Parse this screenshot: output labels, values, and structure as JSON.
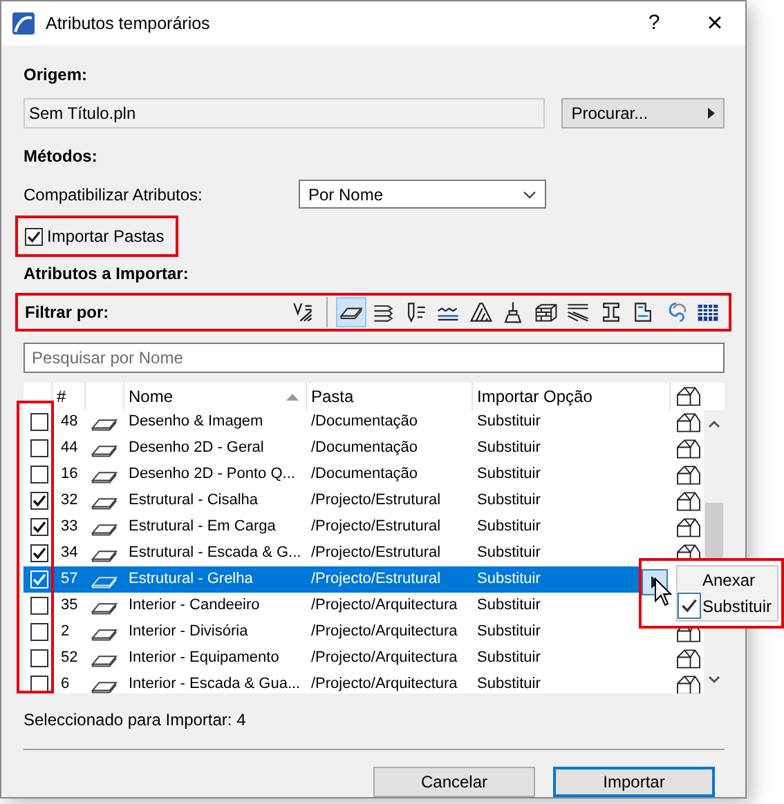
{
  "window": {
    "title": "Atributos temporários",
    "help": "?",
    "close": "×"
  },
  "origin": {
    "label": "Origem:",
    "value": "Sem Título.pln",
    "browse_button": "Procurar..."
  },
  "methods": {
    "label": "Métodos:",
    "match_label": "Compatibilizar Atributos:",
    "match_value": "Por Nome"
  },
  "import_folders": {
    "label": "Importar Pastas",
    "checked": true
  },
  "attributes_label": "Atributos a Importar:",
  "filter": {
    "label": "Filtrar por:",
    "buttons": [
      {
        "selected": false
      },
      {
        "selected": true
      },
      {
        "selected": false
      },
      {
        "selected": false
      },
      {
        "selected": false
      },
      {
        "selected": false
      },
      {
        "selected": false
      },
      {
        "selected": false
      },
      {
        "selected": false
      },
      {
        "selected": false
      },
      {
        "selected": false
      },
      {
        "selected": false
      },
      {
        "selected": false
      }
    ]
  },
  "search": {
    "placeholder": "Pesquisar por Nome"
  },
  "table": {
    "columns": [
      "#",
      "Nome",
      "Pasta",
      "Importar Opção"
    ],
    "rows": [
      {
        "checked": false,
        "number": "48",
        "name": "Desenho & Imagem",
        "folder": "/Documentação",
        "option": "Substituir",
        "selected": false
      },
      {
        "checked": false,
        "number": "44",
        "name": "Desenho 2D - Geral",
        "folder": "/Documentação",
        "option": "Substituir",
        "selected": false
      },
      {
        "checked": false,
        "number": "16",
        "name": "Desenho 2D - Ponto Q...",
        "folder": "/Documentação",
        "option": "Substituir",
        "selected": false
      },
      {
        "checked": true,
        "number": "32",
        "name": "Estrutural - Cisalha",
        "folder": "/Projecto/Estrutural",
        "option": "Substituir",
        "selected": false
      },
      {
        "checked": true,
        "number": "33",
        "name": "Estrutural - Em Carga",
        "folder": "/Projecto/Estrutural",
        "option": "Substituir",
        "selected": false
      },
      {
        "checked": true,
        "number": "34",
        "name": "Estrutural - Escada & G...",
        "folder": "/Projecto/Estrutural",
        "option": "Substituir",
        "selected": false
      },
      {
        "checked": true,
        "number": "57",
        "name": "Estrutural - Grelha",
        "folder": "/Projecto/Estrutural",
        "option": "Substituir",
        "selected": true
      },
      {
        "checked": false,
        "number": "35",
        "name": "Interior - Candeeiro",
        "folder": "/Projecto/Arquitectura",
        "option": "Substituir",
        "selected": false
      },
      {
        "checked": false,
        "number": "2",
        "name": "Interior - Divisória",
        "folder": "/Projecto/Arquitectura",
        "option": "Substituir",
        "selected": false
      },
      {
        "checked": false,
        "number": "52",
        "name": "Interior - Equipamento",
        "folder": "/Projecto/Arquitectura",
        "option": "Substituir",
        "selected": false
      },
      {
        "checked": false,
        "number": "6",
        "name": "Interior - Escada & Gua...",
        "folder": "/Projecto/Arquitectura",
        "option": "Substituir",
        "selected": false
      }
    ]
  },
  "option_menu": {
    "items": [
      {
        "label": "Anexar",
        "checked": false
      },
      {
        "label": "Substituir",
        "checked": true
      }
    ]
  },
  "status": "Seleccionado para Importar: 4",
  "buttons": [
    {
      "label": "Cancelar",
      "default": false
    },
    {
      "label": "Importar",
      "default": true
    }
  ]
}
